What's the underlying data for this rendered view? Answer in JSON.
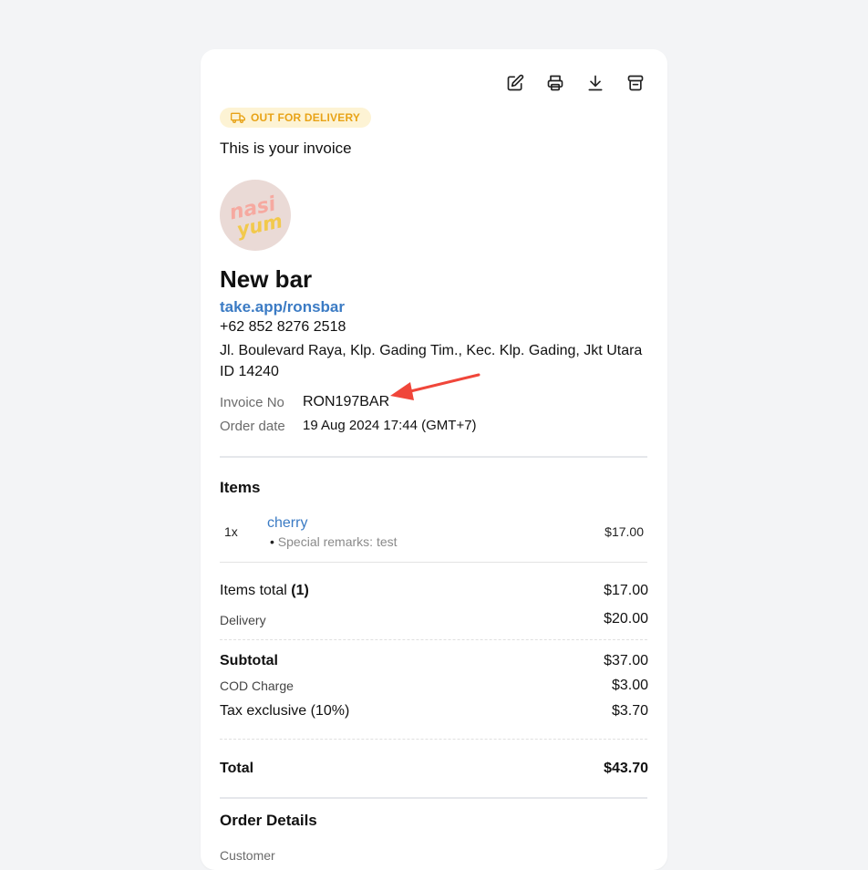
{
  "toolbar": {
    "edit_icon": "edit-icon",
    "print_icon": "printer-icon",
    "download_icon": "download-icon",
    "store_icon": "store-icon"
  },
  "status": {
    "label": "OUT FOR DELIVERY",
    "icon": "truck-icon",
    "color": "#e8a317",
    "background": "#fdf3d4"
  },
  "intro": "This is your invoice",
  "shop": {
    "logo_text_line1": "nasi",
    "logo_text_line2": "yum",
    "name": "New bar",
    "link": "take.app/ronsbar",
    "phone": "+62 852 8276 2518",
    "address": "Jl. Boulevard Raya, Klp. Gading Tim., Kec. Klp. Gading, Jkt Utara ID 14240"
  },
  "invoice": {
    "invoice_no_label": "Invoice No",
    "invoice_no": "RON197BAR",
    "order_date_label": "Order date",
    "order_date": "19 Aug 2024 17:44 (GMT+7)"
  },
  "items_section": {
    "title": "Items",
    "items": [
      {
        "qty": "1x",
        "name": "cherry",
        "remark": "Special remarks: test",
        "price": "$17.00"
      }
    ]
  },
  "totals": {
    "items_total_label": "Items total",
    "items_total_count": "(1)",
    "items_total_value": "$17.00",
    "delivery_label": "Delivery",
    "delivery_value": "$20.00",
    "subtotal_label": "Subtotal",
    "subtotal_value": "$37.00",
    "cod_label": "COD Charge",
    "cod_value": "$3.00",
    "tax_label": "Tax exclusive (10%)",
    "tax_value": "$3.70",
    "total_label": "Total",
    "total_value": "$43.70"
  },
  "order_details": {
    "title": "Order Details",
    "customer_label": "Customer"
  },
  "colors": {
    "link": "#3b7bc4",
    "annotation_arrow": "#f0463a"
  }
}
